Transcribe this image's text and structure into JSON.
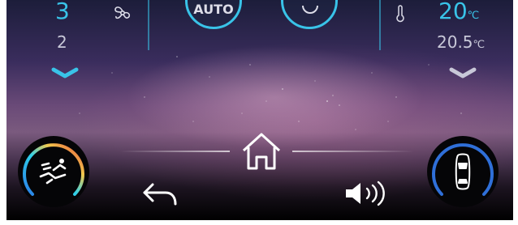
{
  "fan": {
    "speed_value": "3",
    "speed_next": "2",
    "icon": "fan-icon",
    "down_icon": "chevron-down-icon"
  },
  "modes": {
    "auto_label": "AUTO",
    "power_icon": "power-icon"
  },
  "temperature": {
    "set_value": "20",
    "set_unit": "℃",
    "cabin_value": "20.5",
    "cabin_unit": "℃",
    "icon": "thermometer-icon",
    "down_icon": "chevron-down-icon"
  },
  "bottom": {
    "seat_icon": "seat-climate-icon",
    "back_icon": "back-arrow-icon",
    "home_icon": "home-icon",
    "volume_icon": "volume-icon",
    "car_icon": "car-view-icon"
  },
  "colors": {
    "accent": "#39c3e8",
    "text_muted": "#c8c8d8"
  }
}
